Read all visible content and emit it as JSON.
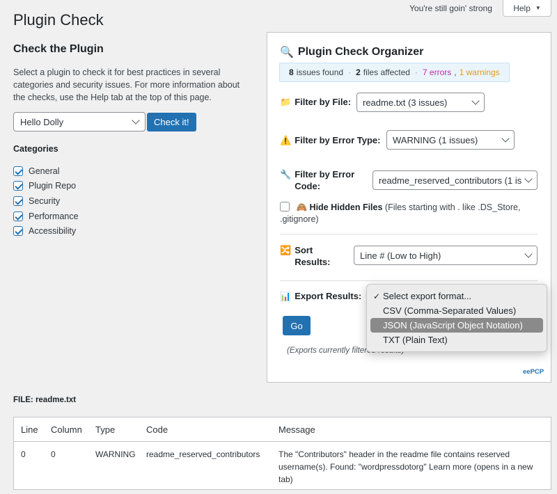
{
  "topbar": {
    "status_text": "You're still goin' strong",
    "help_label": "Help",
    "help_caret": "▼"
  },
  "page": {
    "title": "Plugin Check"
  },
  "check_section": {
    "title": "Check the Plugin",
    "description": "Select a plugin to check it for best practices in several categories and security issues. For more information about the checks, use the Help tab at the top of this page.",
    "plugin_select_value": "Hello Dolly",
    "check_button": "Check it!",
    "categories_title": "Categories",
    "categories": [
      {
        "label": "General",
        "checked": true
      },
      {
        "label": "Plugin Repo",
        "checked": true
      },
      {
        "label": "Security",
        "checked": true
      },
      {
        "label": "Performance",
        "checked": true
      },
      {
        "label": "Accessibility",
        "checked": true
      }
    ]
  },
  "organizer": {
    "icon": "🔍",
    "title": "Plugin Check Organizer",
    "summary": {
      "issues_count": "8",
      "issues_text": "issues found",
      "files_count": "2",
      "files_text": "files affected",
      "errors_text": "7 errors",
      "comma": ",",
      "warnings_text": "1 warnings",
      "dot": "·"
    },
    "filter_file": {
      "icon": "📁",
      "label": "Filter by File:",
      "value": "readme.txt (3 issues)"
    },
    "filter_error_type": {
      "icon": "⚠️",
      "label": "Filter by Error Type:",
      "value": "WARNING (1 issues)"
    },
    "filter_error_code": {
      "icon": "🔧",
      "label_line1": "Filter by Error",
      "label_line2": "Code:",
      "value": "readme_reserved_contributors (1 is"
    },
    "hide_hidden": {
      "icon": "🙈",
      "label": "Hide Hidden Files",
      "note": "(Files starting with . like .DS_Store, .gitignore)"
    },
    "sort": {
      "icon": "🔀",
      "label_line1": "Sort",
      "label_line2": "Results:",
      "value": "Line # (Low to High)"
    },
    "export": {
      "icon": "📊",
      "label": "Export Results:",
      "go_button": "Go",
      "note": "(Exports currently filtered results)"
    },
    "credit": "eePCP"
  },
  "export_dropdown": {
    "options": [
      {
        "label": "Select export format...",
        "selected": true,
        "highlighted": false
      },
      {
        "label": "CSV (Comma-Separated Values)",
        "selected": false,
        "highlighted": false
      },
      {
        "label": "JSON (JavaScript Object Notation)",
        "selected": false,
        "highlighted": true
      },
      {
        "label": "TXT (Plain Text)",
        "selected": false,
        "highlighted": false
      }
    ]
  },
  "results": {
    "file_label": "FILE: readme.txt",
    "columns": [
      "Line",
      "Column",
      "Type",
      "Code",
      "Message"
    ],
    "rows": [
      {
        "line": "0",
        "column": "0",
        "type": "WARNING",
        "code": "readme_reserved_contributors",
        "message": "The \"Contributors\" header in the readme file contains reserved username(s). Found: \"wordpressdotorg\" Learn more (opens in a new tab)"
      }
    ]
  },
  "colors": {
    "primary": "#2271b1",
    "errors": "#c02ba0",
    "warnings": "#e39a1c",
    "summary_bg": "#eaf4fb"
  }
}
